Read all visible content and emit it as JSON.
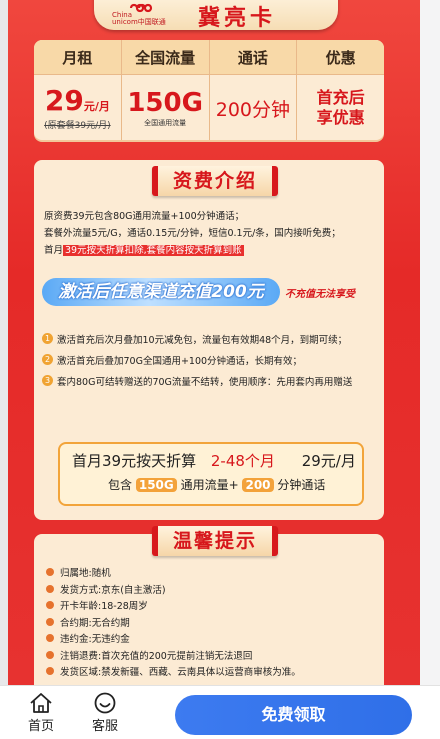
{
  "brand": {
    "en_line1": "China",
    "en_line2": "unicom中国联通",
    "card_name": "冀亮卡"
  },
  "price_table": {
    "headers": [
      "月租",
      "全国流量",
      "通话",
      "优惠"
    ],
    "price_value": "29",
    "price_unit": "元/月",
    "original_price": "(原套餐39元/月)",
    "flow_value": "150G",
    "flow_sub": "全国通用流量",
    "call": "200分钟",
    "promo_line1": "首充后",
    "promo_line2": "享优惠"
  },
  "intro": {
    "title": "资费介绍",
    "line1": "原资费39元包含80G通用流量+100分钟通话；",
    "line2": "套餐外流量5元/G，通话0.15元/分钟，短信0.1元/条，国内接听免费；",
    "line3_prefix": "首月",
    "line3_highlight": "39元按天折算扣除,套餐内容按天折算到账",
    "rebate_text": "激活后任意渠道充值200元",
    "rebate_note": "不充值无法享受",
    "items": [
      {
        "num": "1",
        "text": "激活首充后次月叠加10元减免包，流量包有效期48个月，到期可续；"
      },
      {
        "num": "2",
        "text": "激活首充后叠加70G全国通用+100分钟通话，长期有效；"
      },
      {
        "num": "3",
        "text": "套内80G可结转赠送的70G流量不结转，使用顺序：先用套内再用赠送"
      }
    ],
    "deal": {
      "line1_a": "首月39元按天折算",
      "line1_b": "2-48个月",
      "line1_c": "29元/月",
      "line2_a": "包含",
      "line2_b": "150G",
      "line2_c": "通用流量+",
      "line2_d": "200",
      "line2_e": "分钟通话"
    }
  },
  "tips": {
    "title": "温馨提示",
    "items": [
      "归属地:随机",
      "发货方式:京东(自主激活)",
      "开卡年龄:18-28周岁",
      "合约期:无合约期",
      "违约金:无违约金",
      "注销退费:首次充值的200元提前注销无法退回",
      "发货区域:禁发新疆、西藏、云南具体以运营商审核为准。"
    ]
  },
  "bottom_nav": {
    "home_label": "首页",
    "service_label": "客服",
    "cta_label": "免费领取"
  },
  "colors": {
    "accent_red": "#d7171c",
    "cta_blue": "#3d7bf0",
    "cream": "#fcebd4"
  },
  "icons": {
    "home": "home-icon",
    "service": "smile-chat-icon",
    "logo": "unicom-knot-icon"
  }
}
